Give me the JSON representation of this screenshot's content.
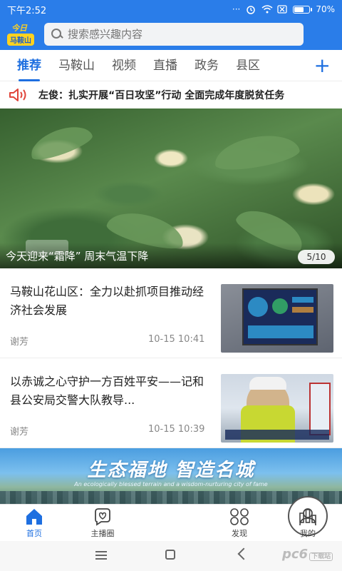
{
  "status_bar": {
    "time": "下午2:52",
    "dots": "···",
    "battery_text": "70%",
    "battery_level": 0.7
  },
  "header": {
    "logo_top": "今日",
    "logo_bottom": "马鞍山",
    "search_placeholder": "搜索感兴趣内容"
  },
  "tabs": [
    {
      "label": "推荐",
      "active": true
    },
    {
      "label": "马鞍山",
      "active": false
    },
    {
      "label": "视频",
      "active": false
    },
    {
      "label": "直播",
      "active": false
    },
    {
      "label": "政务",
      "active": false
    },
    {
      "label": "县区",
      "active": false
    }
  ],
  "tab_add": "+",
  "ticker": {
    "icon": "speaker-icon",
    "text": "左俊：扎实开展“百日攻坚”行动 全面完成年度脱贫任务"
  },
  "hero": {
    "caption": "今天迎来“霜降” 周末气温下降",
    "badge": "5/10"
  },
  "news": [
    {
      "title": "马鞍山花山区：全力以赴抓项目推动经济社会发展",
      "author": "谢芳",
      "time": "10-15 10:41"
    },
    {
      "title": " 以赤诚之心守护一方百姓平安——记和县公安局交警大队教导...",
      "author": "谢芳",
      "time": "10-15 10:39"
    }
  ],
  "banner": {
    "title": "生态福地  智造名城",
    "subtitle": "An ecologically blessed terrain and a wisdom-nurturing city of fame"
  },
  "bottom_nav": [
    {
      "label": "首页",
      "icon": "home-icon",
      "active": true
    },
    {
      "label": "主播圈",
      "icon": "heart-chat-icon",
      "active": false
    },
    {
      "label": "",
      "icon": "bar-chart-icon",
      "active": false
    },
    {
      "label": "发现",
      "icon": "discover-icon",
      "active": false
    },
    {
      "label": "我的",
      "icon": "user-icon",
      "active": false
    }
  ],
  "watermark": {
    "text": "pc6",
    "small": "下载站"
  },
  "colors": {
    "brand": "#2a7de9",
    "accent": "#1e6fe0",
    "alert": "#e0443a"
  }
}
